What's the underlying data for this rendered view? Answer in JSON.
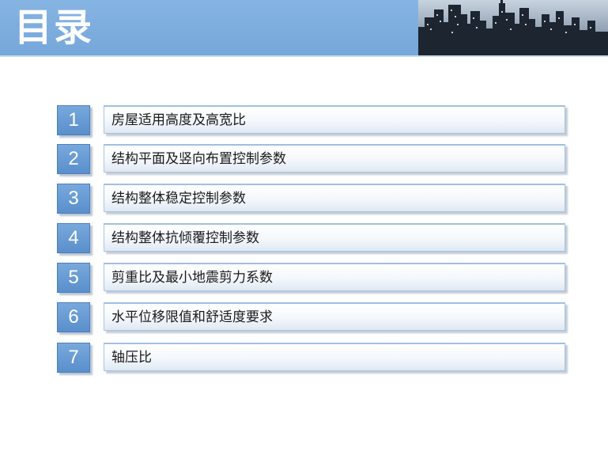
{
  "header": {
    "title": "目录",
    "image_icon": "city-skyline-photo",
    "colors": {
      "bar": "#7dadde",
      "number_box": "#5a8fcc",
      "label_border": "#a9c5e2"
    }
  },
  "toc": {
    "items": [
      {
        "number": "1",
        "label": "房屋适用高度及高宽比"
      },
      {
        "number": "2",
        "label": "结构平面及竖向布置控制参数"
      },
      {
        "number": "3",
        "label": "结构整体稳定控制参数"
      },
      {
        "number": "4",
        "label": "结构整体抗倾覆控制参数"
      },
      {
        "number": "5",
        "label": "剪重比及最小地震剪力系数"
      },
      {
        "number": "6",
        "label": "水平位移限值和舒适度要求"
      },
      {
        "number": "7",
        "label": "轴压比"
      }
    ]
  }
}
